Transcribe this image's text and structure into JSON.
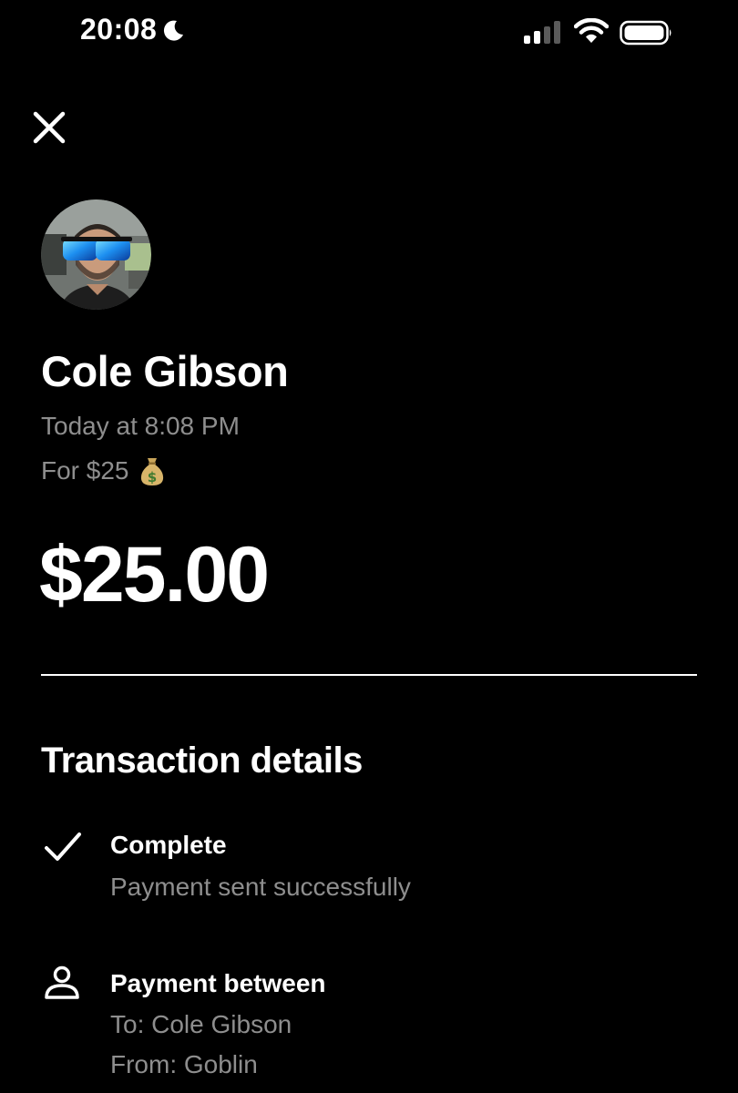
{
  "status_bar": {
    "time": "20:08",
    "icons": [
      "moon-icon",
      "signal-icon",
      "wifi-icon",
      "battery-icon"
    ]
  },
  "header": {
    "close_icon": "close-icon"
  },
  "contact": {
    "name": "Cole Gibson",
    "timestamp": "Today at 8:08 PM",
    "note": "For $25",
    "note_emoji_icon": "money-bag-icon"
  },
  "amount": "$25.00",
  "transaction": {
    "title": "Transaction details",
    "status": {
      "icon": "check-icon",
      "label": "Complete",
      "description": "Payment sent successfully"
    },
    "parties": {
      "icon": "person-icon",
      "label": "Payment between",
      "to": "To: Cole Gibson",
      "from": "From: Goblin"
    }
  },
  "colors": {
    "background": "#000000",
    "primary_text": "#ffffff",
    "secondary_text": "#8e8e8e"
  }
}
